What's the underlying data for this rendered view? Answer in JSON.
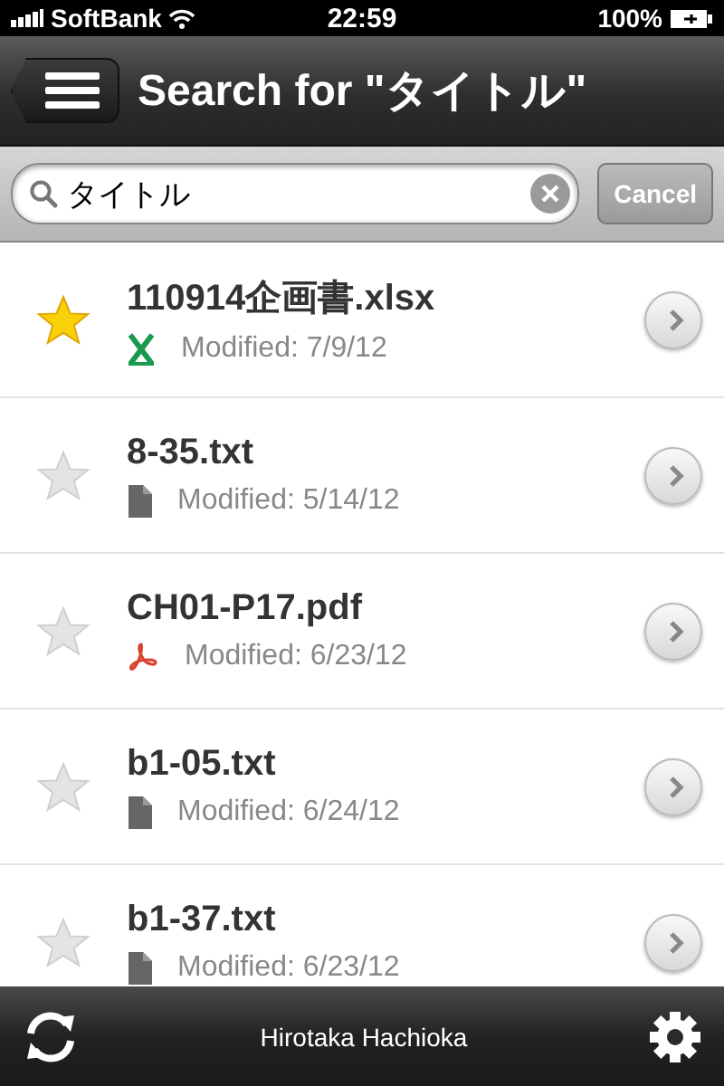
{
  "status_bar": {
    "carrier": "SoftBank",
    "time": "22:59",
    "battery": "100%"
  },
  "nav_bar": {
    "title": "Search for \"タイトル\""
  },
  "search": {
    "value": "タイトル",
    "cancel": "Cancel"
  },
  "files": [
    {
      "name": "110914企画書.xlsx",
      "kind": "excel",
      "starred": true,
      "modified": "Modified: 7/9/12"
    },
    {
      "name": "8-35.txt",
      "kind": "text",
      "starred": false,
      "modified": "Modified: 5/14/12"
    },
    {
      "name": "CH01-P17.pdf",
      "kind": "pdf",
      "starred": false,
      "modified": "Modified: 6/23/12"
    },
    {
      "name": "b1-05.txt",
      "kind": "text",
      "starred": false,
      "modified": "Modified: 6/24/12"
    },
    {
      "name": "b1-37.txt",
      "kind": "text",
      "starred": false,
      "modified": "Modified: 6/23/12"
    }
  ],
  "toolbar": {
    "user": "Hirotaka Hachioka"
  }
}
